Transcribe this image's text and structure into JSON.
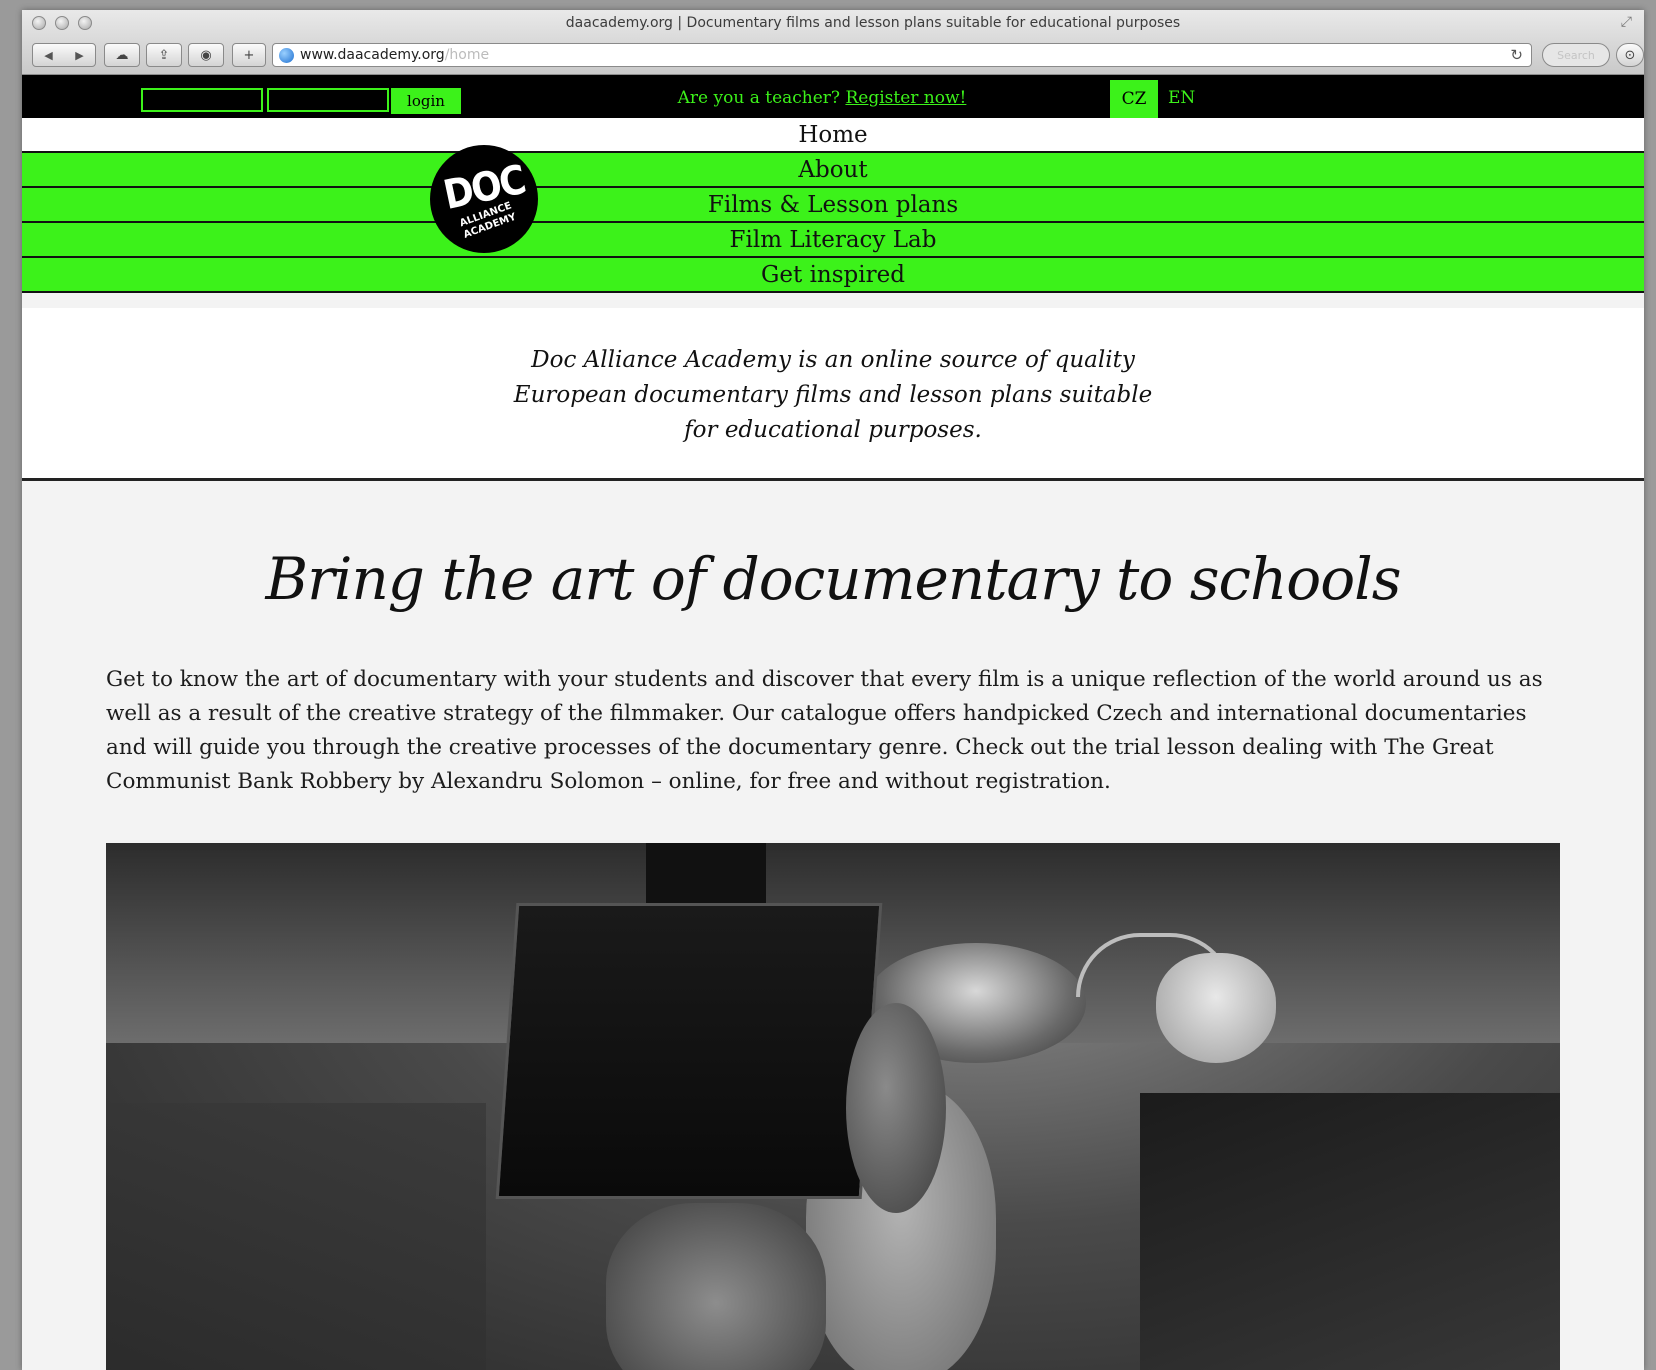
{
  "browser": {
    "window_title": "daacademy.org | Documentary films and lesson plans suitable for educational purposes",
    "url_host": "www.daacademy.org",
    "url_path": "/home",
    "search_placeholder": "Search"
  },
  "topbar": {
    "login_label": "login",
    "teacher_prompt": "Are you a teacher?",
    "register_link": "Register now!",
    "lang_cz": "CZ",
    "lang_en": "EN"
  },
  "logo": {
    "line1": "DOC",
    "line2": "ALLIANCE",
    "line3": "ACADEMY"
  },
  "menu": {
    "items": [
      {
        "label": "Home"
      },
      {
        "label": "About"
      },
      {
        "label": "Films & Lesson plans"
      },
      {
        "label": "Film Literacy Lab"
      },
      {
        "label": "Get inspired"
      }
    ]
  },
  "intro": {
    "text": "Doc Alliance Academy is an online source of quality European documentary films and lesson plans suitable for educational purposes."
  },
  "main": {
    "headline": "Bring the art of documentary to schools",
    "body": "Get to know the art of documentary with your students and discover that every film is a unique reflection of the world around us as well as a result of the creative strategy of the filmmaker. Our catalogue offers handpicked Czech and international documentaries and will guide you through the creative processes of the documentary genre. Check out the trial lesson dealing with The Great Communist Bank Robbery by Alexandru Solomon – online, for free and without registration."
  },
  "colors": {
    "accent": "#3cf21a",
    "topbar_bg": "#000000",
    "page_bg": "#f3f3f3"
  },
  "icons": [
    "back-icon",
    "forward-icon",
    "icloud-icon",
    "share-icon",
    "history-icon",
    "add-tab-icon",
    "globe-icon",
    "reload-icon",
    "downloads-icon"
  ]
}
